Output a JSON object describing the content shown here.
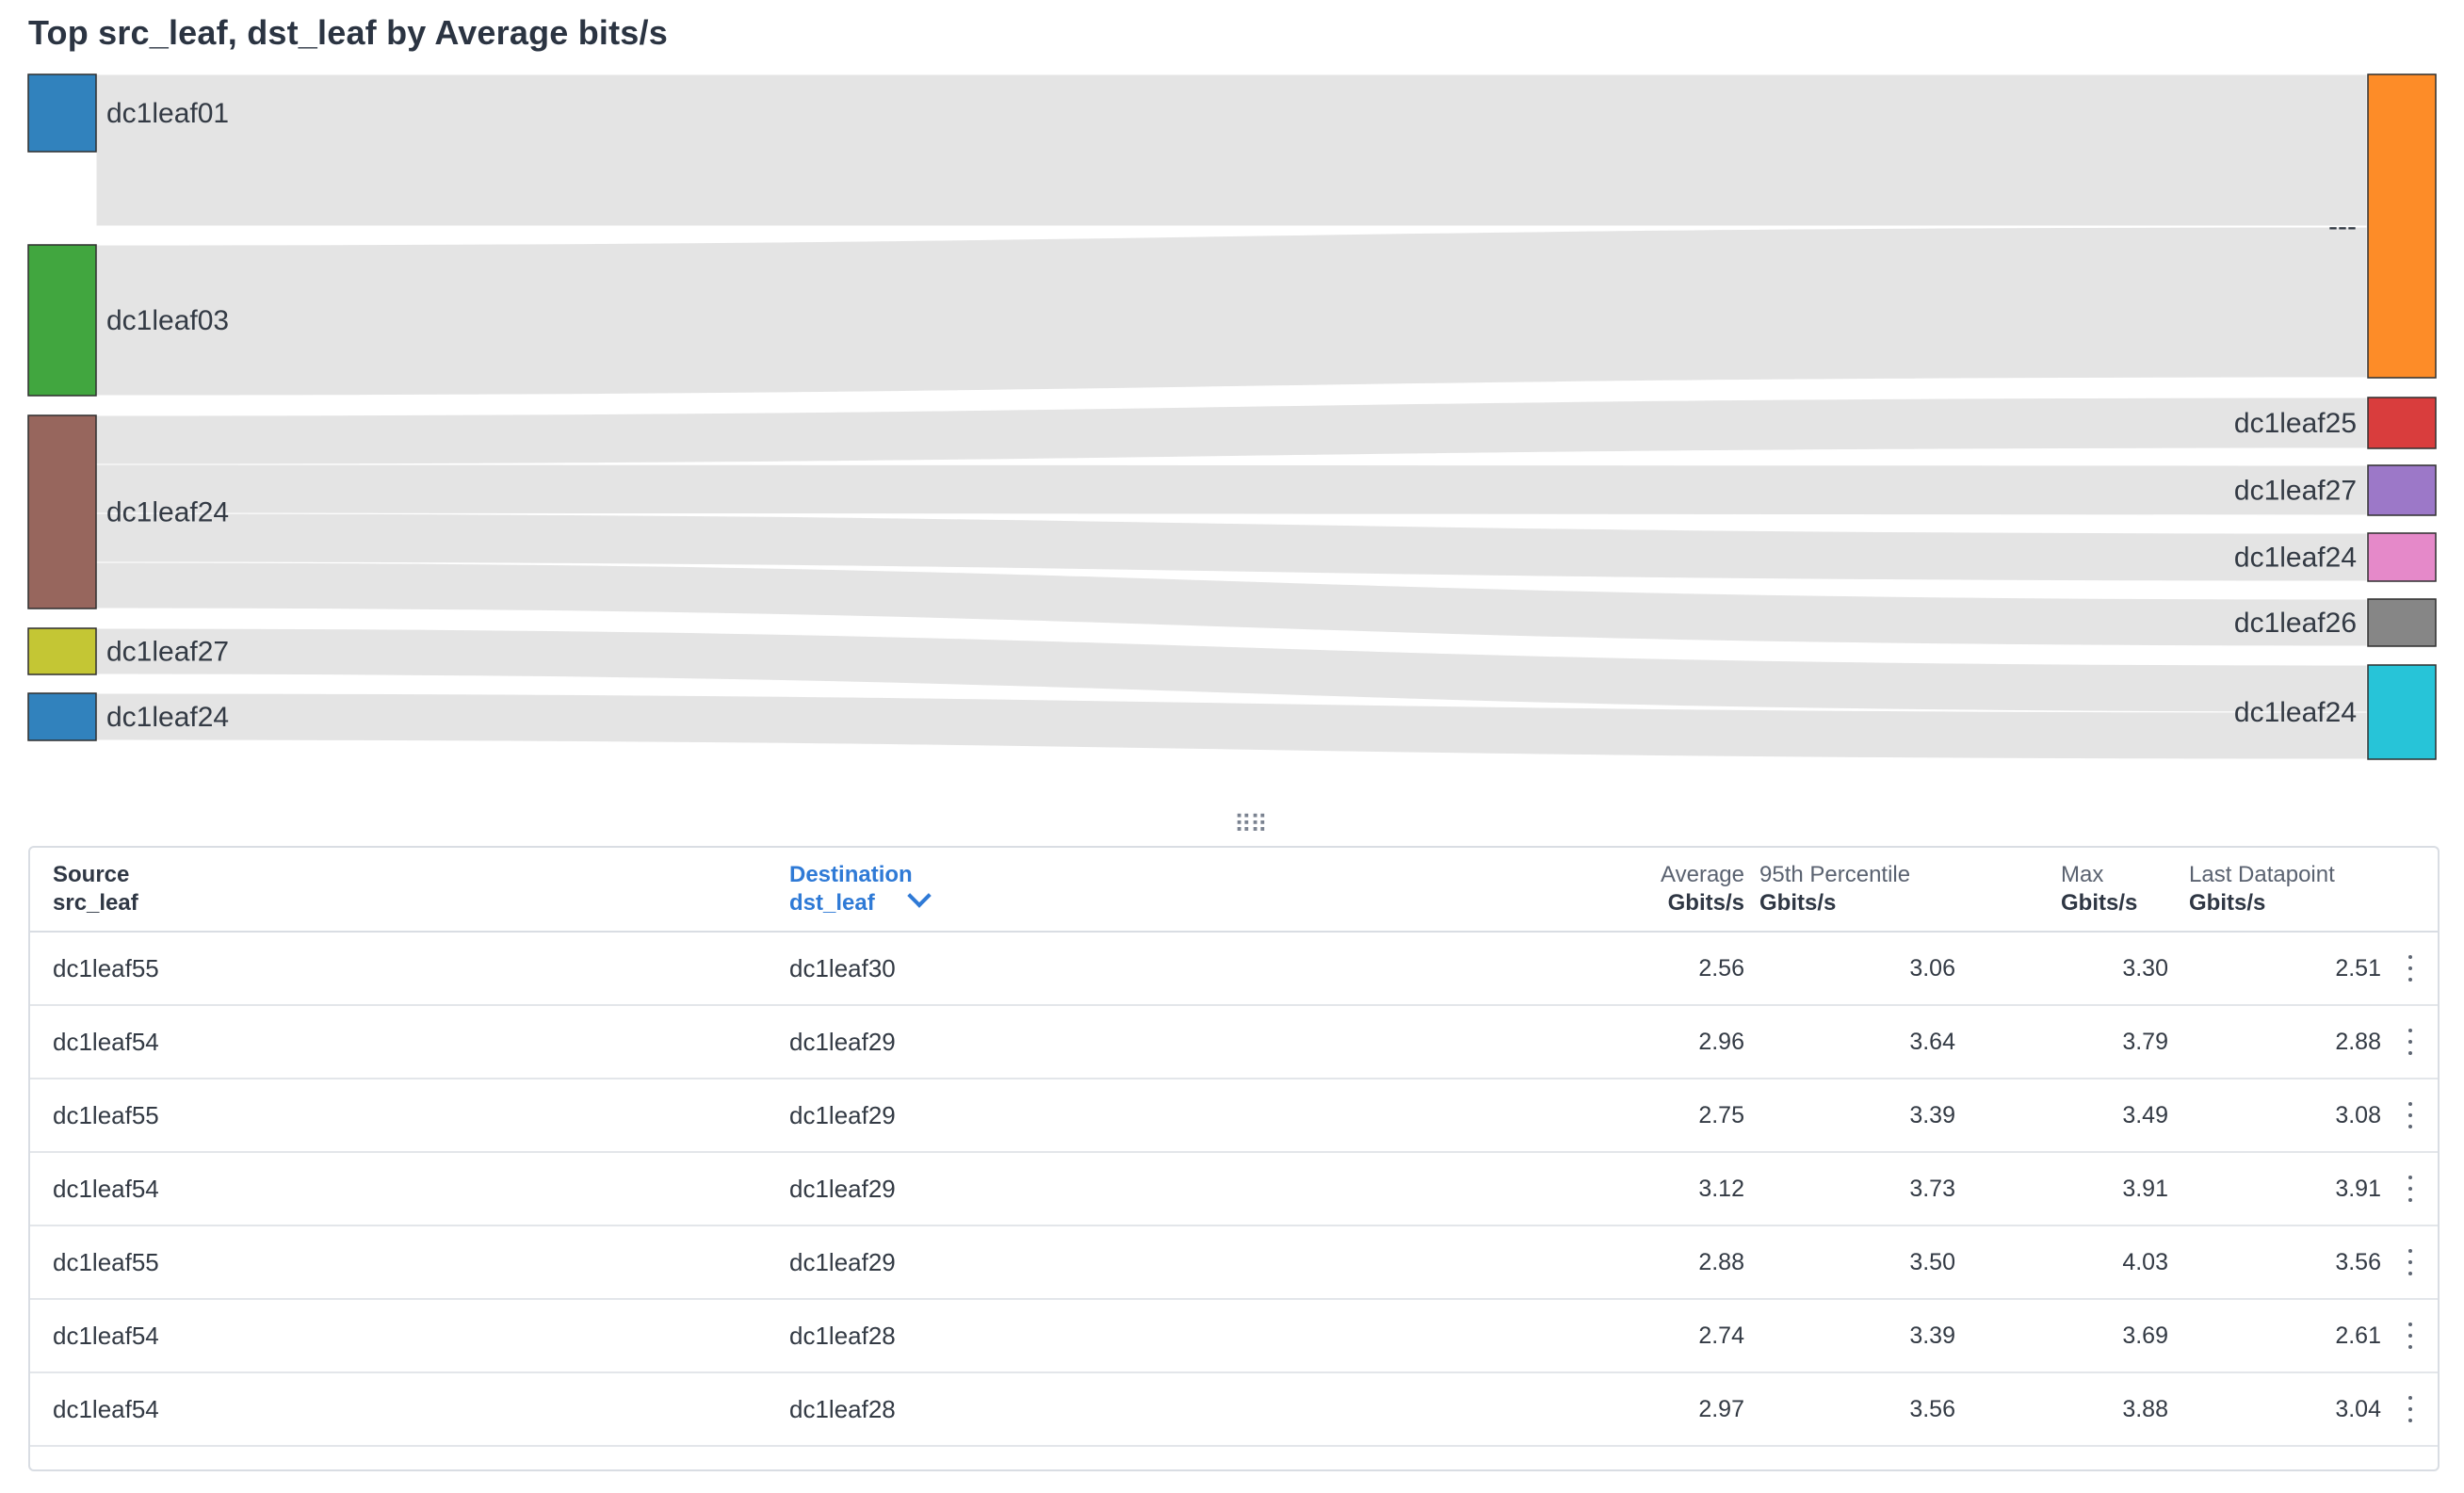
{
  "title": "Top src_leaf, dst_leaf by Average bits/s",
  "sankey": {
    "link_color": "#e3e3e3",
    "sources": [
      {
        "label": "dc1leaf01",
        "color": "#3182bd"
      },
      {
        "label": "dc1leaf03",
        "color": "#41a63f"
      },
      {
        "label": "dc1leaf24",
        "color": "#97665d"
      },
      {
        "label": "dc1leaf27",
        "color": "#c4c634"
      },
      {
        "label": "dc1leaf24",
        "color": "#3182bd"
      }
    ],
    "targets": [
      {
        "label": "---",
        "color": "#fd8c28"
      },
      {
        "label": "dc1leaf25",
        "color": "#d93d3d"
      },
      {
        "label": "dc1leaf27",
        "color": "#9c78c8"
      },
      {
        "label": "dc1leaf24",
        "color": "#e589c9"
      },
      {
        "label": "dc1leaf26",
        "color": "#868686"
      },
      {
        "label": "dc1leaf24",
        "color": "#27c4d8"
      }
    ],
    "links": [
      {
        "source": 0,
        "target": 0
      },
      {
        "source": 1,
        "target": 0
      },
      {
        "source": 2,
        "target": 1
      },
      {
        "source": 2,
        "target": 2
      },
      {
        "source": 2,
        "target": 3
      },
      {
        "source": 2,
        "target": 4
      },
      {
        "source": 3,
        "target": 5
      },
      {
        "source": 4,
        "target": 5
      }
    ]
  },
  "table": {
    "headers": {
      "source": {
        "top": "Source",
        "sub": "src_leaf"
      },
      "destination": {
        "top": "Destination",
        "sub": "dst_leaf"
      },
      "average": {
        "top": "Average",
        "sub": "Gbits/s"
      },
      "p95": {
        "top": "95th Percentile",
        "sub": "Gbits/s"
      },
      "max": {
        "top": "Max",
        "sub": "Gbits/s"
      },
      "last": {
        "top": "Last Datapoint",
        "sub": "Gbits/s"
      }
    },
    "rows": [
      {
        "source": "dc1leaf55",
        "destination": "dc1leaf30",
        "average": "2.56",
        "p95": "3.06",
        "max": "3.30",
        "last": "2.51"
      },
      {
        "source": "dc1leaf54",
        "destination": "dc1leaf29",
        "average": "2.96",
        "p95": "3.64",
        "max": "3.79",
        "last": "2.88"
      },
      {
        "source": "dc1leaf55",
        "destination": "dc1leaf29",
        "average": "2.75",
        "p95": "3.39",
        "max": "3.49",
        "last": "3.08"
      },
      {
        "source": "dc1leaf54",
        "destination": "dc1leaf29",
        "average": "3.12",
        "p95": "3.73",
        "max": "3.91",
        "last": "3.91"
      },
      {
        "source": "dc1leaf55",
        "destination": "dc1leaf29",
        "average": "2.88",
        "p95": "3.50",
        "max": "4.03",
        "last": "3.56"
      },
      {
        "source": "dc1leaf54",
        "destination": "dc1leaf28",
        "average": "2.74",
        "p95": "3.39",
        "max": "3.69",
        "last": "2.61"
      },
      {
        "source": "dc1leaf54",
        "destination": "dc1leaf28",
        "average": "2.97",
        "p95": "3.56",
        "max": "3.88",
        "last": "3.04"
      }
    ]
  }
}
